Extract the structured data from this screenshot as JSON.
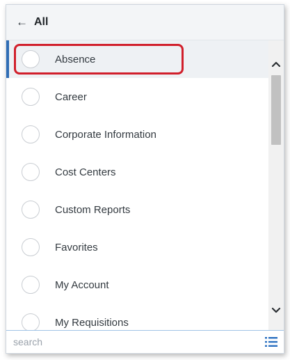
{
  "header": {
    "back_label": "All",
    "back_icon": "left-arrow-icon"
  },
  "items": [
    {
      "label": "Absence",
      "selected": true
    },
    {
      "label": "Career"
    },
    {
      "label": "Corporate Information"
    },
    {
      "label": "Cost Centers"
    },
    {
      "label": "Custom Reports"
    },
    {
      "label": "Favorites"
    },
    {
      "label": "My Account"
    },
    {
      "label": "My Requisitions"
    }
  ],
  "scrollbar": {
    "up_icon": "chevron-up-icon",
    "down_icon": "chevron-down-icon"
  },
  "search": {
    "placeholder": "search",
    "value": ""
  },
  "colors": {
    "highlight_box": "#d11f2b",
    "selected_bg": "#eef1f4",
    "selected_bar": "#2f6db5",
    "list_icon": "#2a6fc0"
  }
}
